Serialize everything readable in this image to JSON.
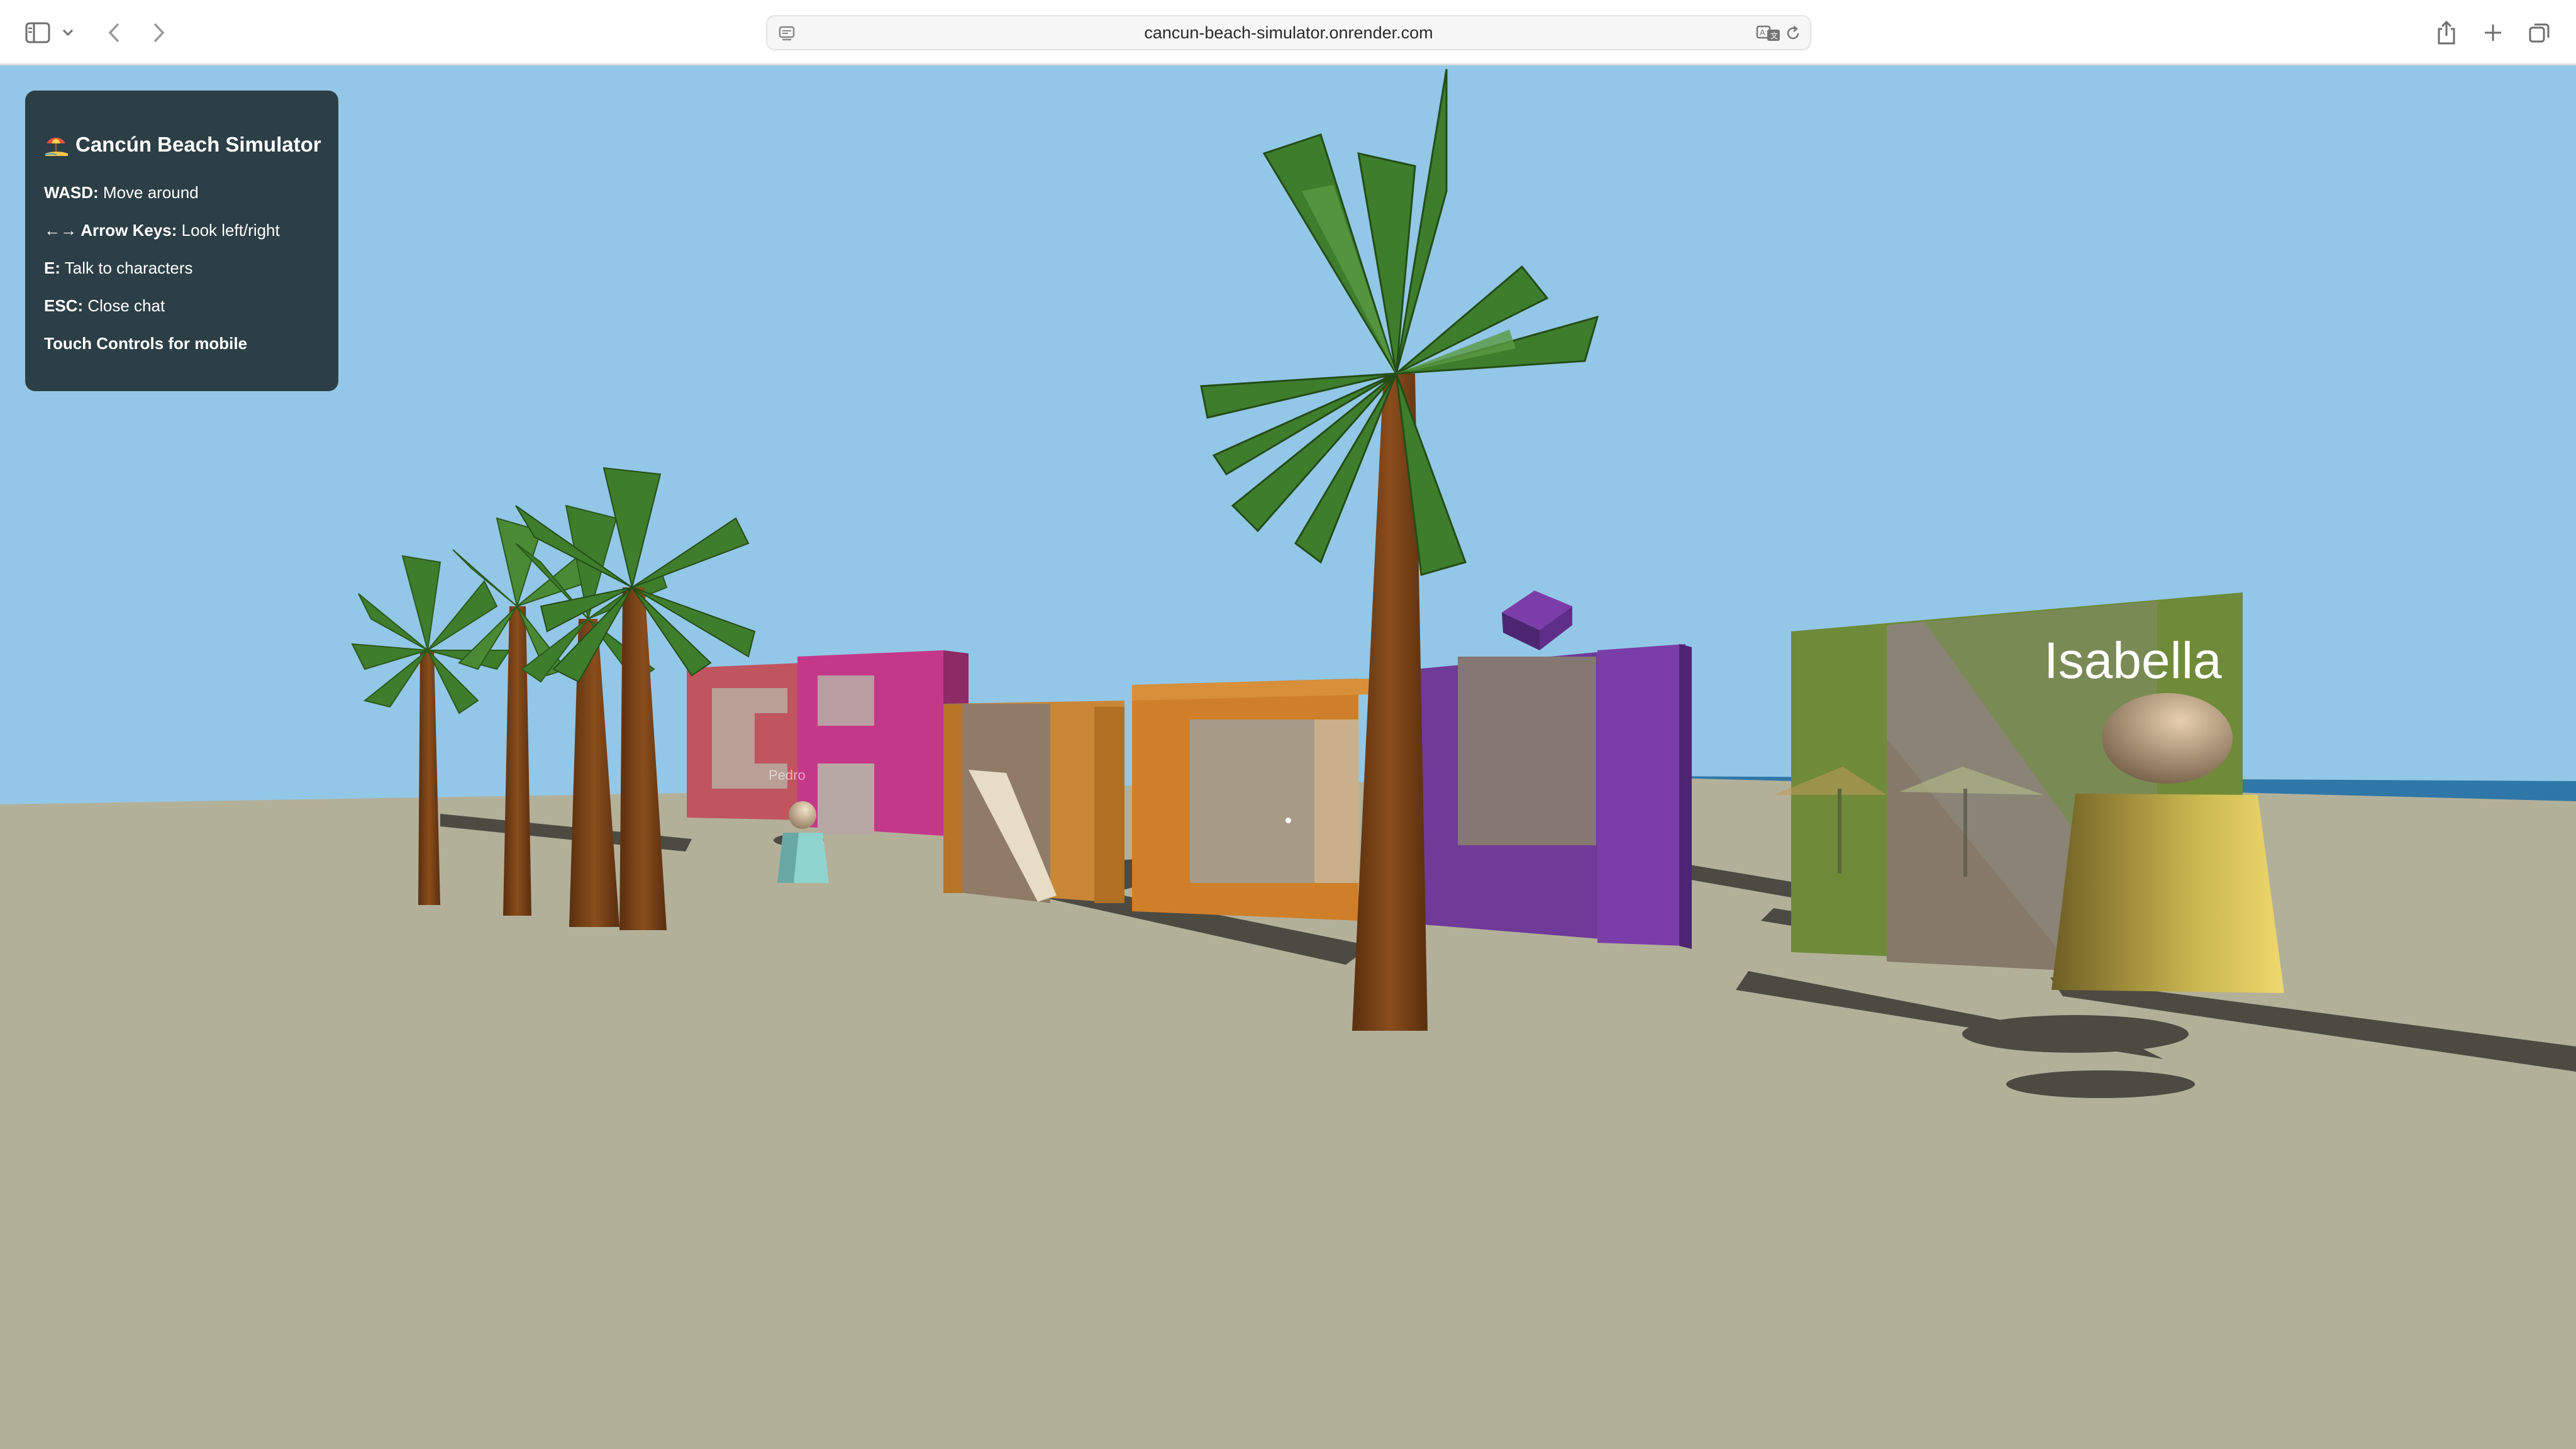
{
  "browser": {
    "url": "cancun-beach-simulator.onrender.com",
    "icons": [
      "sidebar-icon",
      "chevron-down-icon",
      "back-icon",
      "forward-icon",
      "page-settings-icon",
      "translate-icon",
      "reload-icon",
      "share-icon",
      "new-tab-icon",
      "tab-overview-icon"
    ]
  },
  "hud": {
    "title": "Cancún Beach Simulator",
    "title_icon": "beach-umbrella-icon",
    "controls": [
      {
        "key": "WASD:",
        "desc": "Move around"
      },
      {
        "key": "←→ Arrow Keys:",
        "desc": "Look left/right"
      },
      {
        "key": "E:",
        "desc": "Talk to characters"
      },
      {
        "key": "ESC:",
        "desc": "Close chat"
      }
    ],
    "mobile_note": "Touch Controls for mobile"
  },
  "scene": {
    "characters": [
      {
        "name": "Isabella",
        "body_color": "#d4bf52"
      },
      {
        "name": "Pedro",
        "body_color": "#8fd3cf"
      }
    ],
    "sign_letters": [
      {
        "letter": "C",
        "color": "#c0545f"
      },
      {
        "letter": "A",
        "color": "#c4388a"
      },
      {
        "letter": "N",
        "color": "#c98636"
      },
      {
        "letter": "C",
        "color": "#cf7f2a"
      },
      {
        "letter": "U",
        "color": "#7b3ea8"
      },
      {
        "letter": "N",
        "color": "#6f8a39"
      }
    ],
    "colors": {
      "sky": "#93c7e7",
      "sand": "#b3b09a",
      "sea": "#2f77a8",
      "palm_trunk": "#7a4519",
      "palm_leaves": "#3e7d2c"
    }
  }
}
